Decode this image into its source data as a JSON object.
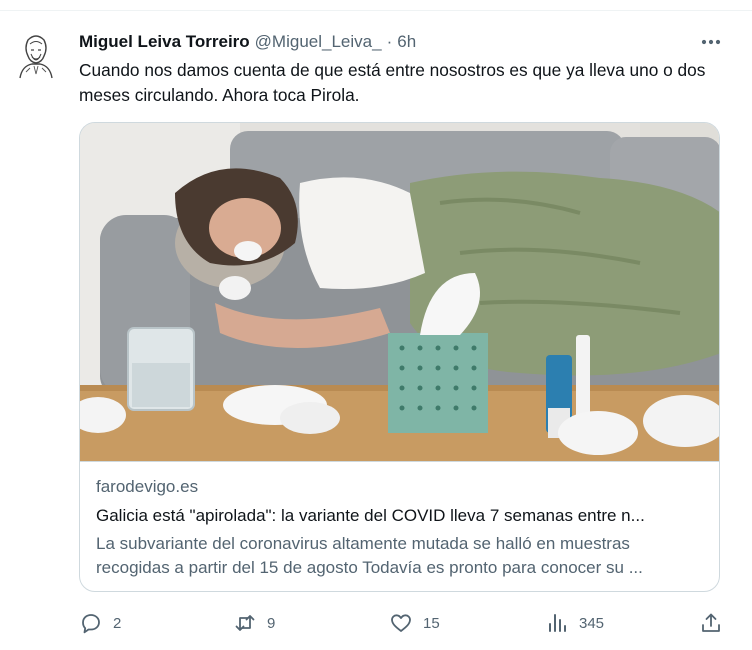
{
  "tweet": {
    "author_name": "Miguel Leiva Torreiro",
    "author_handle": "@Miguel_Leiva_",
    "separator": "·",
    "time": "6h",
    "text": "Cuando nos damos cuenta de que está entre nosostros es que ya lleva uno o dos meses circulando. Ahora toca Pirola."
  },
  "card": {
    "domain": "farodevigo.es",
    "title": "Galicia está \"apirolada\": la variante del COVID lleva 7 semanas entre n...",
    "description": "La subvariante del coronavirus altamente mutada se halló en muestras recogidas a partir del 15 de agosto Todavía es pronto para conocer su ..."
  },
  "actions": {
    "replies": "2",
    "retweets": "9",
    "likes": "15",
    "views": "345"
  },
  "icons": [
    "avatar-sketch",
    "more-icon",
    "reply-icon",
    "retweet-icon",
    "like-icon",
    "views-icon",
    "share-icon"
  ],
  "colors": {
    "text": "#0f1419",
    "secondary": "#536471",
    "border": "#cfd9de"
  }
}
